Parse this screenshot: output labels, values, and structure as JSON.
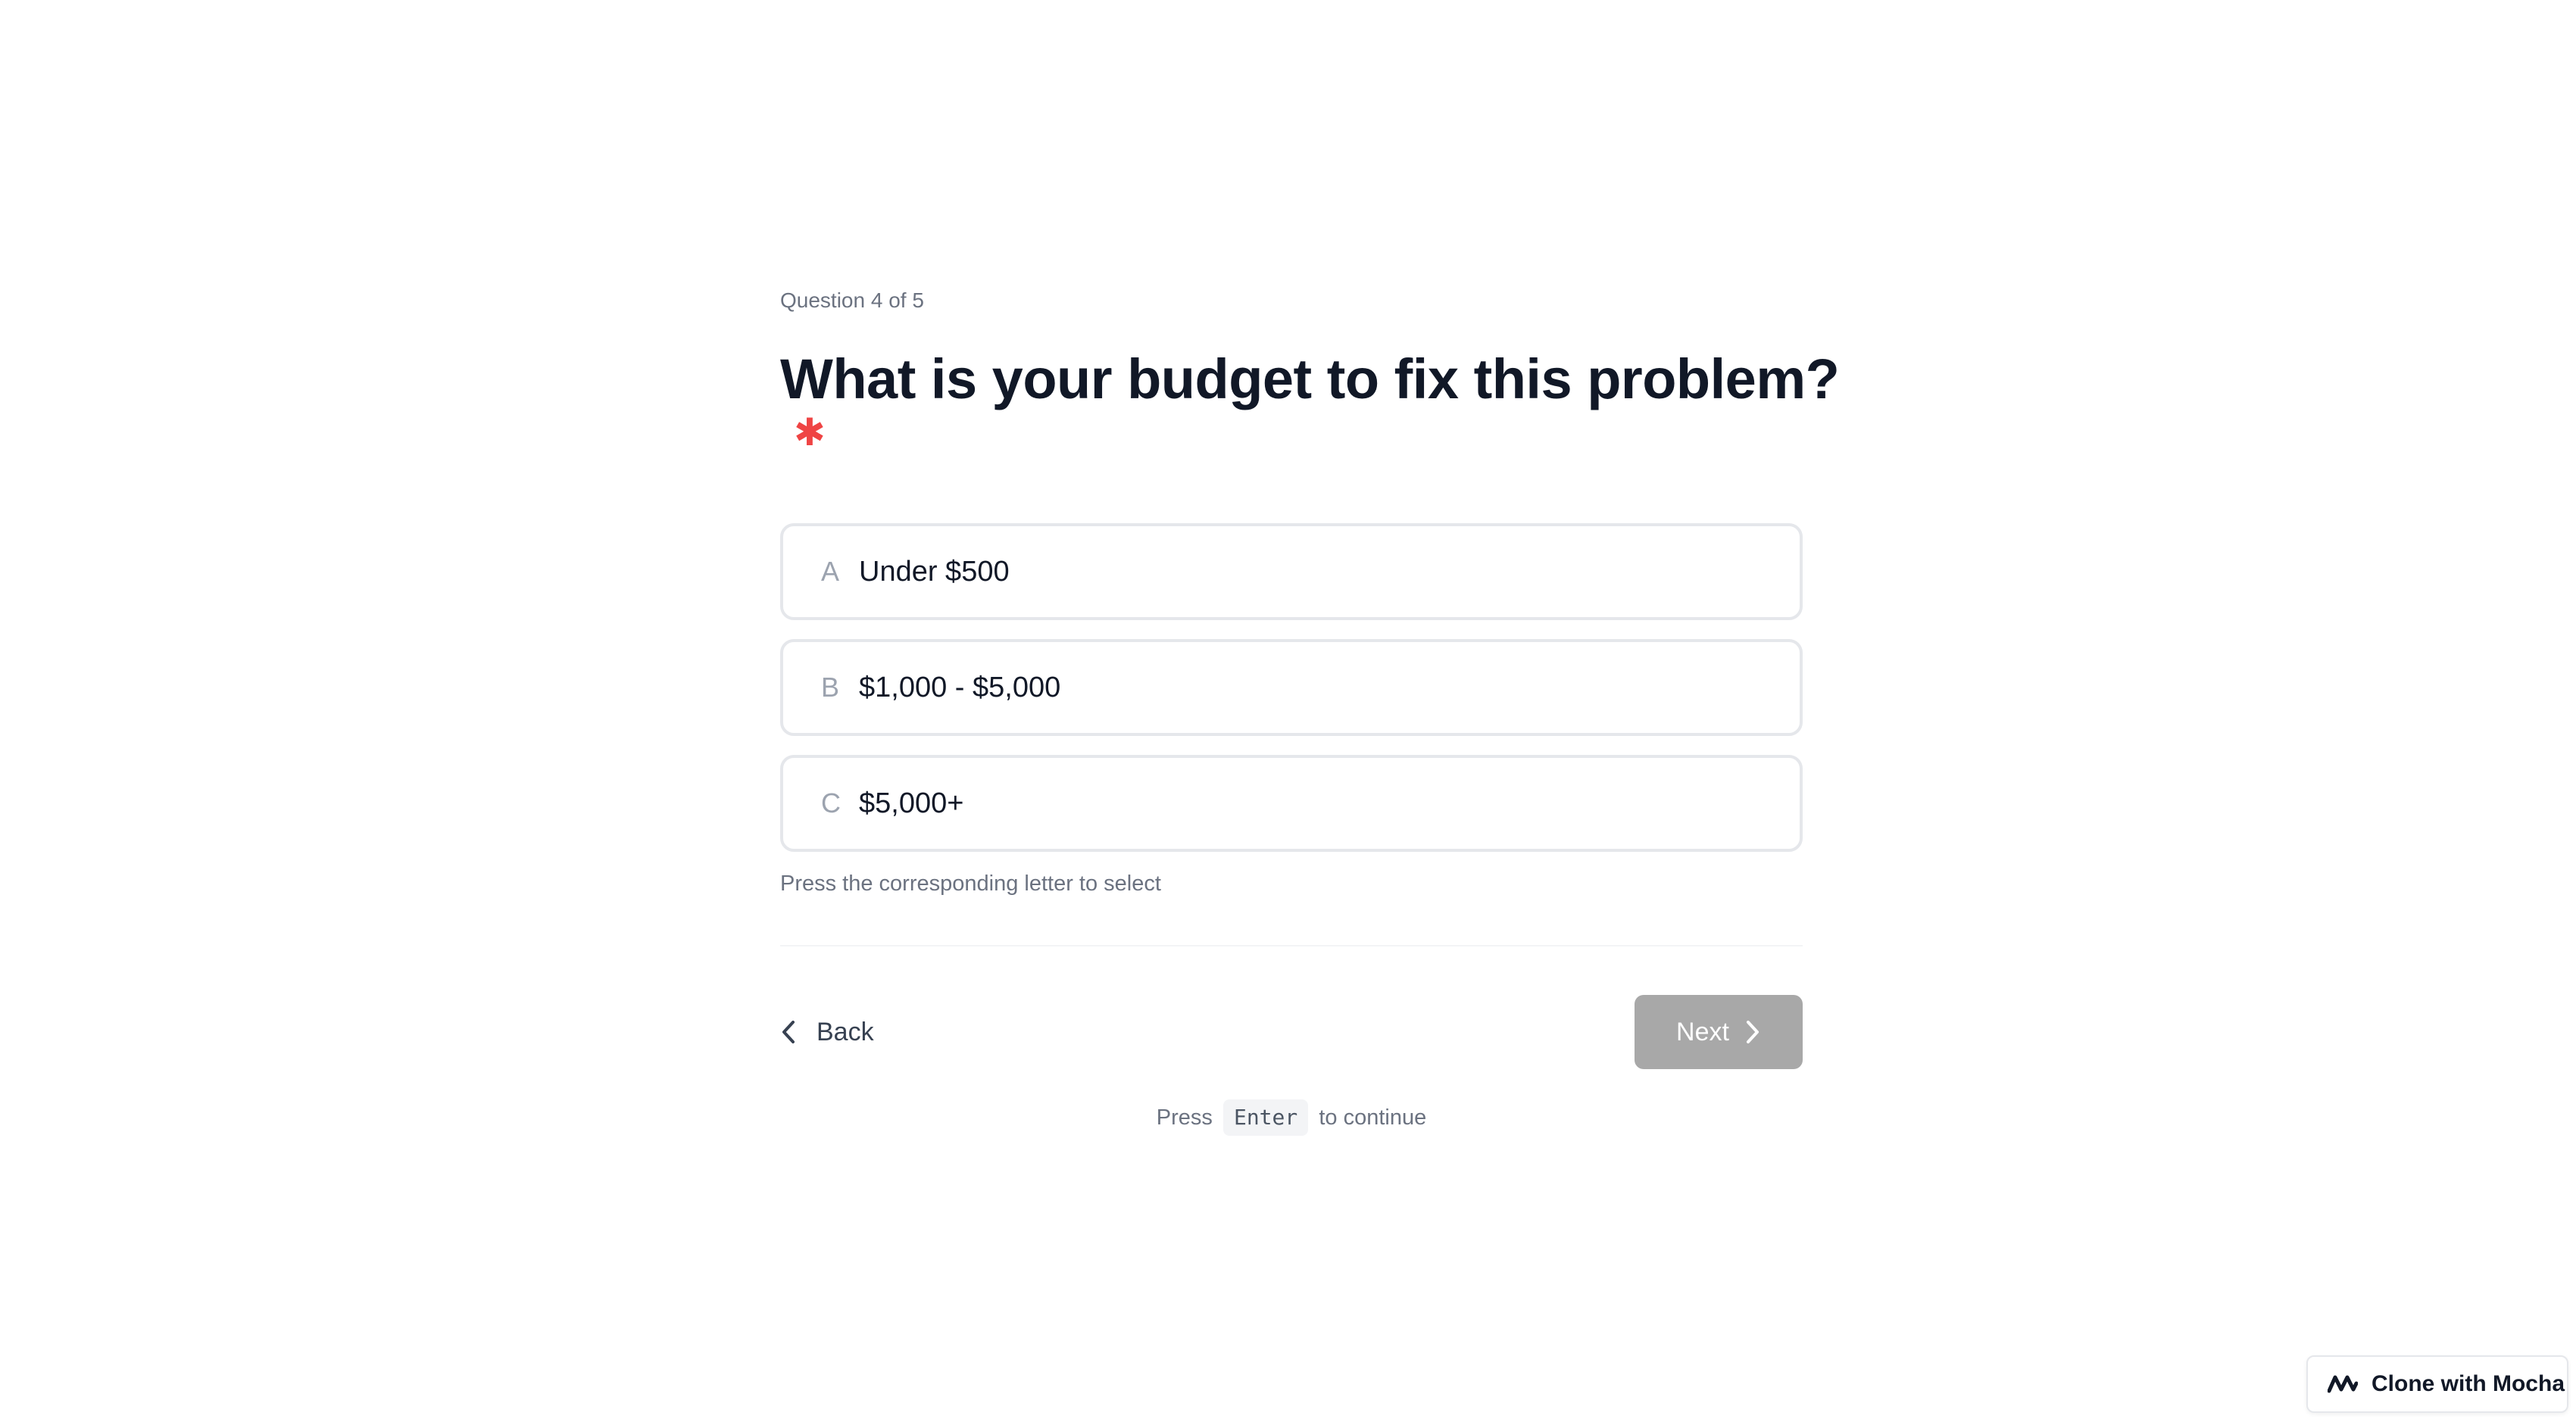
{
  "form": {
    "progress": "Question 4 of 5",
    "question": "What is your budget to fix this problem?",
    "required_mark": "✱",
    "options": [
      {
        "key": "A",
        "label": "Under $500"
      },
      {
        "key": "B",
        "label": "$1,000 - $5,000"
      },
      {
        "key": "C",
        "label": "$5,000+"
      }
    ],
    "hint": "Press the corresponding letter to select"
  },
  "nav": {
    "back_label": "Back",
    "next_label": "Next",
    "enter_prefix": "Press",
    "enter_key": "Enter",
    "enter_suffix": "to continue"
  },
  "badge": {
    "label": "Clone with Mocha",
    "icon": "mocha-logo-icon"
  },
  "colors": {
    "required": "#ef4444",
    "next_disabled": "#a8a8a8",
    "option_border": "#e5e7eb"
  }
}
